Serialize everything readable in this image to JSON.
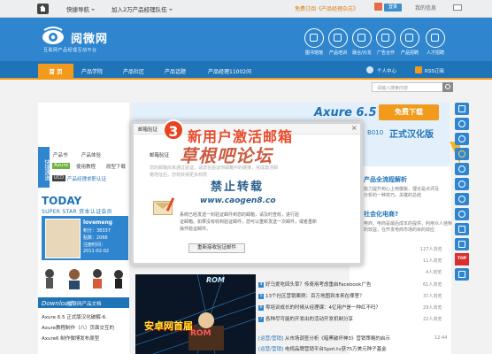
{
  "topbar": {
    "quick_nav": "快捷导航",
    "join": "加入2万产品经理队伍",
    "subscribe": "免费订阅《产品经理杂志》",
    "login": "登录",
    "my_info": "我的信息"
  },
  "header": {
    "logo_name": "阅微网",
    "logo_sub": "互联网产品经理互动平台",
    "icons": [
      {
        "label": "图书馆馆",
        "icon": "book-icon"
      },
      {
        "label": "产品培训",
        "icon": "training-icon"
      },
      {
        "label": "融合/沙龙",
        "icon": "salon-icon"
      },
      {
        "label": "广告合作",
        "icon": "ad-icon"
      },
      {
        "label": "产品招聘",
        "icon": "recruit-icon"
      },
      {
        "label": "人才招聘",
        "icon": "talent-icon"
      }
    ]
  },
  "nav": {
    "home": "首 页",
    "items": [
      "产品学院",
      "产品社区",
      "产品话题",
      "产品经理11002问"
    ],
    "user_center": "个人中心",
    "rss": "RSS订阅"
  },
  "search": {
    "placeholder": "请输入搜索内容"
  },
  "left": {
    "quick_label": "快捷通道",
    "quick_items": [
      "产品书",
      "产品体验",
      "使用教程",
      "原型下载",
      "产品经理求职认证"
    ],
    "axure_tag": "Axure",
    "ucd_tag": "UCD",
    "today": "TODAY",
    "superstar": "SUPER STAR 资本认证会员",
    "star": {
      "name": "lovemeng",
      "points": "积分：38337",
      "posts": "贴数：2066",
      "reg": "注册时间：",
      "date": "2011-02-02"
    },
    "download_head": "Download",
    "download_sub": "互联网产品文档",
    "download_items": [
      "Axure 6.5 正式版汉化破解-6.",
      "Axure教程制作（八）页面交互的",
      "Axure6 制作微博发布原型"
    ]
  },
  "banner": {
    "title": "Axure 6.5",
    "button": "免费下载",
    "subtitle": "正式汉化版",
    "build": "B010"
  },
  "right": {
    "title1": "产品全流程解析",
    "lines1": [
      "能力提升到心上用模板，理论是点评及",
      "分析的一种技巧。关键的总结"
    ],
    "title2": "社会化电商?",
    "lines2": [
      "电商，电商是最后成本的提供，利用众人拾柴",
      "的效益，在开发电商市场的目的效应"
    ]
  },
  "news": [
    {
      "num": "",
      "text": "",
      "views": "127人浏览"
    },
    {
      "num": "",
      "text": "",
      "views": "11人浏览"
    },
    {
      "num": "",
      "text": "",
      "views": "4人浏览"
    },
    {
      "num": "4",
      "text": "好马爱吃回头草？传奇用考虑重启Facebook广告",
      "views": "61人浏览"
    },
    {
      "num": "5",
      "text": "13个社区营销案例：百万地图到本来在哪里？",
      "views": "37人浏览"
    },
    {
      "num": "6",
      "text": "零培训成长的时候从经理课：4亿用户是一种红不吗？",
      "views": "29人浏览"
    },
    {
      "num": "7",
      "text": "各种尽可能的开发出的活动开发机制分享",
      "views": "22人浏览"
    }
  ],
  "news_bottom": [
    {
      "tag": "[运营/营销]",
      "text": "从市场调查分析《暗黑破坏神3》营销策略的启示",
      "time": "12:44"
    },
    {
      "tag": "[运营/营销]",
      "text": "电视品牌营销平台Spot.tv获75万美元种子基金",
      "time": ""
    }
  ],
  "side_tools": [
    "book-icon",
    "chart-icon",
    "user-icon",
    "weibo-icon",
    "qq-icon",
    "friend-icon",
    "list-icon"
  ],
  "top_button": "TOP",
  "ad": {
    "text1": "安卓网首届",
    "text2": "ROM",
    "text3": "ROM"
  },
  "modal": {
    "title": "邮箱验证",
    "badge": "3",
    "tab": "邮箱验证",
    "watermark1": "新用户激活邮箱",
    "watermark2": "草根吧论坛",
    "watermark3": "禁止转载",
    "watermark4": "www.caogen8.co",
    "lines": [
      "您的邮箱尚未通过验证，请您在验证你邮箱中的链接，完成激活邮",
      "箱地址后，您将获得更多权限"
    ],
    "text1": "系统已经发送一封验证邮件到您的邮箱，请及时查收，进行验",
    "text2": "证邮箱。如果没有收到验证邮件，您可以重新发送一次邮件，或者重新",
    "text3": "操作验证邮件。",
    "resend": "重新接收验证邮件",
    "close": "×"
  }
}
